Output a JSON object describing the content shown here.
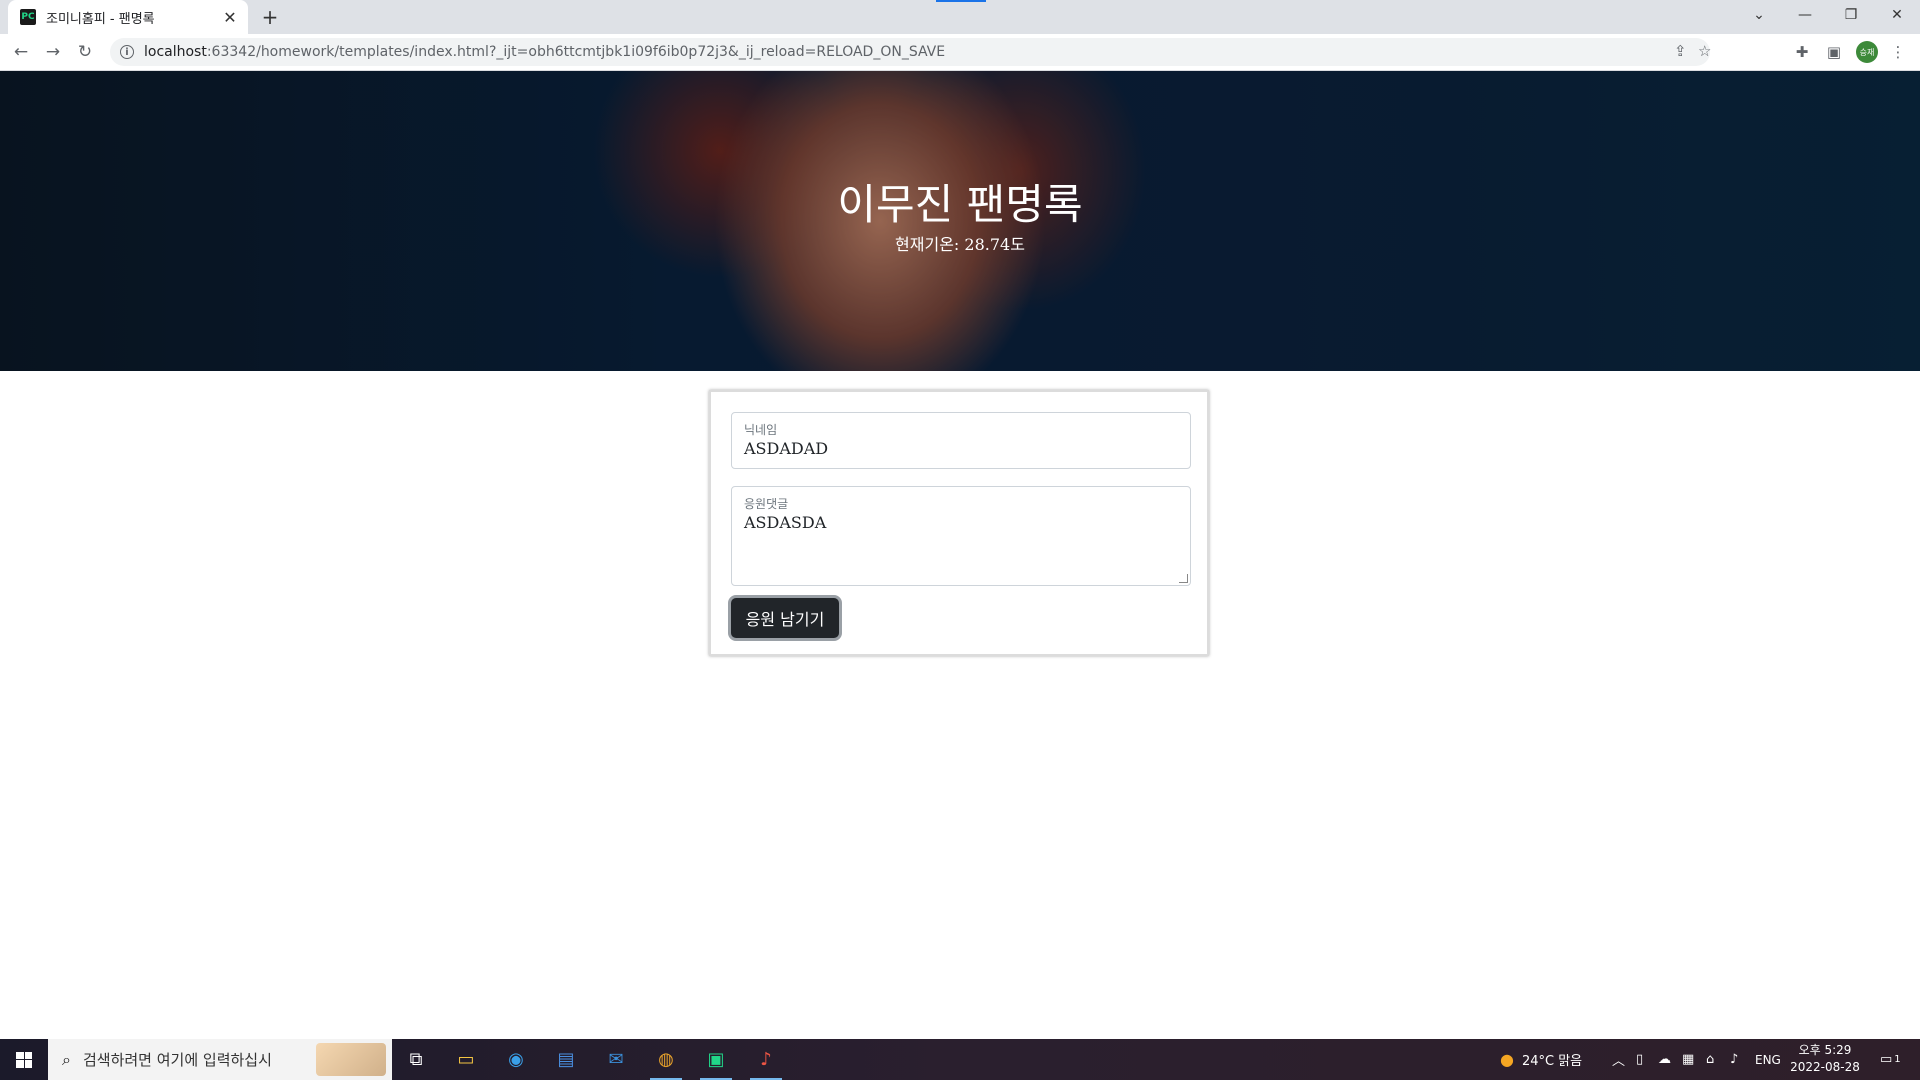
{
  "browser": {
    "tab_title": "조미니홈피 - 팬명록",
    "tab_favicon": "PC",
    "url_host": "localhost",
    "url_rest": ":63342/homework/templates/index.html?_ijt=obh6ttcmtjbk1i09f6ib0p72j3&_ij_reload=RELOAD_ON_SAVE",
    "profile_initials": "승재"
  },
  "hero": {
    "title": "이무진 팬명록",
    "subtitle": "현재기온: 28.74도"
  },
  "form": {
    "nickname_label": "닉네임",
    "nickname_value": "ASDADAD",
    "comment_label": "응원댓글",
    "comment_value": "ASDASDA",
    "submit_label": "응원 남기기"
  },
  "taskbar": {
    "search_placeholder": "검색하려면 여기에 입력하십시",
    "weather": "24°C  맑음",
    "lang": "ENG",
    "time": "오후 5:29",
    "date": "2022-08-28",
    "notification_count": "1"
  }
}
